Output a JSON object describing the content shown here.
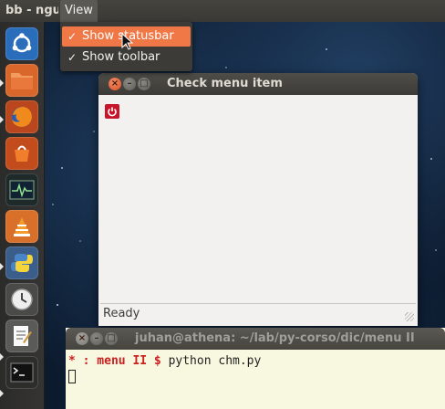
{
  "top_panel": {
    "app_title": "bb - ngu",
    "menu_view": "View"
  },
  "view_menu": {
    "items": [
      {
        "label": "Show statusbar",
        "checked": true,
        "check_glyph": "✓",
        "highlighted": true
      },
      {
        "label": "Show toolbar",
        "checked": true,
        "check_glyph": "✓",
        "highlighted": false
      }
    ]
  },
  "launcher": {
    "items": [
      {
        "icon": "ubuntu-dash-icon"
      },
      {
        "icon": "files-folder-icon"
      },
      {
        "icon": "firefox-icon"
      },
      {
        "icon": "software-center-icon"
      },
      {
        "icon": "system-monitor-icon"
      },
      {
        "icon": "vlc-icon"
      },
      {
        "icon": "python-icon"
      },
      {
        "icon": "clock-icon"
      },
      {
        "icon": "text-editor-icon"
      },
      {
        "icon": "terminal-icon"
      }
    ]
  },
  "gtk_window": {
    "title": "Check menu item",
    "toolbar": {
      "quit_icon": "power-icon"
    },
    "statusbar": "Ready"
  },
  "terminal": {
    "title": "juhan@athena: ~/lab/py-corso/dic/menu II",
    "prompt_star": "*",
    "prompt": " : menu II $ ",
    "command": "python chm.py"
  },
  "colors": {
    "menu_highlight": "#f07746",
    "panel": "#3c3b37",
    "close_button": "#e05a2a",
    "toolbar_button": "#c7162b",
    "terminal_bg": "#f8f8e0",
    "prompt": "#cc2020"
  }
}
